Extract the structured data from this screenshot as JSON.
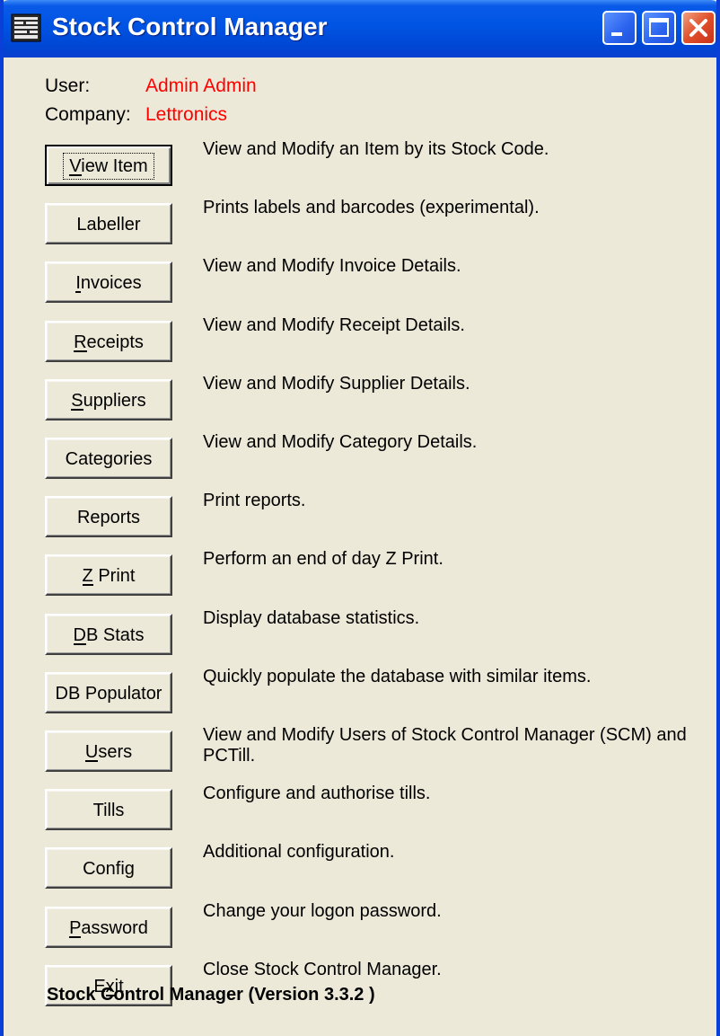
{
  "window": {
    "title": "Stock Control Manager",
    "icon": "stock-app-icon"
  },
  "info": {
    "user_label": "User:",
    "user_value": "Admin Admin",
    "company_label": "Company:",
    "company_value": "Lettronics"
  },
  "buttons": [
    {
      "id": "view-item",
      "label": "View Item",
      "mnemonic": "V",
      "description": "View and Modify an Item by its Stock Code.",
      "default": true
    },
    {
      "id": "labeller",
      "label": "Labeller",
      "mnemonic": "",
      "description": "Prints labels and barcodes (experimental)."
    },
    {
      "id": "invoices",
      "label": "Invoices",
      "mnemonic": "I",
      "description": "View and Modify Invoice Details."
    },
    {
      "id": "receipts",
      "label": "Receipts",
      "mnemonic": "R",
      "description": "View and Modify Receipt Details."
    },
    {
      "id": "suppliers",
      "label": "Suppliers",
      "mnemonic": "S",
      "description": "View and Modify Supplier Details."
    },
    {
      "id": "categories",
      "label": "Categories",
      "mnemonic": "",
      "description": "View and Modify Category Details."
    },
    {
      "id": "reports",
      "label": "Reports",
      "mnemonic": "",
      "description": "Print reports."
    },
    {
      "id": "z-print",
      "label": "Z Print",
      "mnemonic": "Z",
      "description": "Perform an end of day Z Print."
    },
    {
      "id": "db-stats",
      "label": "DB Stats",
      "mnemonic": "D",
      "description": "Display database statistics."
    },
    {
      "id": "db-populator",
      "label": "DB Populator",
      "mnemonic": "",
      "description": "Quickly populate the database with similar items."
    },
    {
      "id": "users",
      "label": "Users",
      "mnemonic": "U",
      "description": "View and Modify Users of Stock Control Manager (SCM) and PCTill."
    },
    {
      "id": "tills",
      "label": "Tills",
      "mnemonic": "",
      "description": "Configure and authorise tills."
    },
    {
      "id": "config",
      "label": "Config",
      "mnemonic": "",
      "description": "Additional configuration."
    },
    {
      "id": "password",
      "label": "Password",
      "mnemonic": "P",
      "description": "Change your logon password."
    },
    {
      "id": "exit",
      "label": "Exit",
      "mnemonic": "x",
      "description": "Close Stock Control Manager."
    }
  ],
  "footer": {
    "version_text": "Stock Control Manager (Version 3.3.2 )"
  },
  "colors": {
    "titlebar": "#0054e3",
    "window_bg": "#ece9d8",
    "info_value": "#ff0000"
  }
}
